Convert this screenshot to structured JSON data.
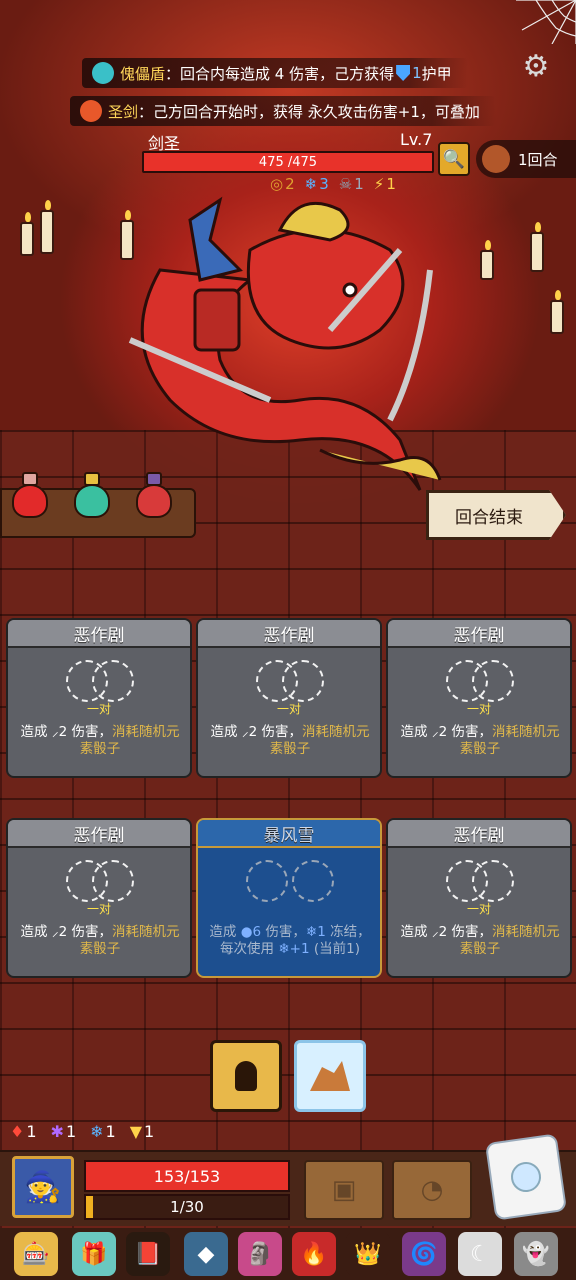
{
  "colors": {
    "accent_yellow": "#ffd65a",
    "hp_red": "#e8322a",
    "card_gray": "#5e6066",
    "card_blue": "#1d4f8f",
    "highlight_gold": "#e0b84a"
  },
  "header": {
    "settings_icon": "gear-icon"
  },
  "buffs": [
    {
      "icon": "puppet-shield-icon",
      "name": "傀儡盾",
      "text": "：回合内每造成 4 伤害，己方获得 ",
      "tail_value": "1",
      "tail_text": " 护甲"
    },
    {
      "icon": "holy-sword-icon",
      "name": "圣剑",
      "text": "：己方回合开始时，获得 永久攻击伤害+1，可叠加"
    }
  ],
  "boss": {
    "name": "剑圣",
    "level": "Lv.7",
    "hp_text": "475 /475",
    "hp_fraction": 1.0,
    "stats": [
      {
        "icon": "shield-icon",
        "value": "2"
      },
      {
        "icon": "snowflake-icon",
        "value": "3"
      },
      {
        "icon": "skull-icon",
        "value": "1"
      },
      {
        "icon": "lightning-icon",
        "value": "1"
      }
    ]
  },
  "round": {
    "label": "1回合"
  },
  "end_turn_label": "回合结束",
  "cards": [
    {
      "title": "恶作剧",
      "slot_label": "一对",
      "desc_pre": "造成 ",
      "desc_dmg": "2 伤害，",
      "desc_hl": "消耗随机元素骰子"
    },
    {
      "title": "恶作剧",
      "slot_label": "一对",
      "desc_pre": "造成 ",
      "desc_dmg": "2 伤害，",
      "desc_hl": "消耗随机元素骰子"
    },
    {
      "title": "恶作剧",
      "slot_label": "一对",
      "desc_pre": "造成 ",
      "desc_dmg": "2 伤害，",
      "desc_hl": "消耗随机元素骰子"
    },
    {
      "title": "恶作剧",
      "slot_label": "一对",
      "desc_pre": "造成 ",
      "desc_dmg": "2 伤害，",
      "desc_hl": "消耗随机元素骰子"
    },
    {
      "title": "暴风雪",
      "desc_line1": "造成 ",
      "desc_hl1": "6",
      "desc_line1b": " 伤害，",
      "desc_hl2": "1",
      "desc_line1c": " 冻结",
      "desc_line2": "，每次使用 ",
      "desc_hl3": "+1",
      "desc_line2b": " (当前1)"
    },
    {
      "title": "恶作剧",
      "slot_label": "一对",
      "desc_pre": "造成 ",
      "desc_dmg": "2 伤害，",
      "desc_hl": "消耗随机元素骰子"
    }
  ],
  "dice_counts": [
    {
      "icon": "fire-dice-icon",
      "value": "1",
      "color": "#ff4a3a"
    },
    {
      "icon": "arcane-dice-icon",
      "value": "1",
      "color": "#b06aff"
    },
    {
      "icon": "ice-dice-icon",
      "value": "1",
      "color": "#5ab4ff"
    },
    {
      "icon": "gold-dice-icon",
      "value": "1",
      "color": "#ffd24a"
    }
  ],
  "player": {
    "hp_text": "153/153",
    "hp_fraction": 1.0,
    "xp_text": "1/30",
    "xp_fraction": 0.033
  },
  "relics": [
    "slot-machine-icon",
    "gift-box-icon",
    "spellbook-icon",
    "stone-icon",
    "totem-icon",
    "flame-icon",
    "crown-icon",
    "vortex-icon",
    "moon-icon",
    "ghost-icon"
  ]
}
